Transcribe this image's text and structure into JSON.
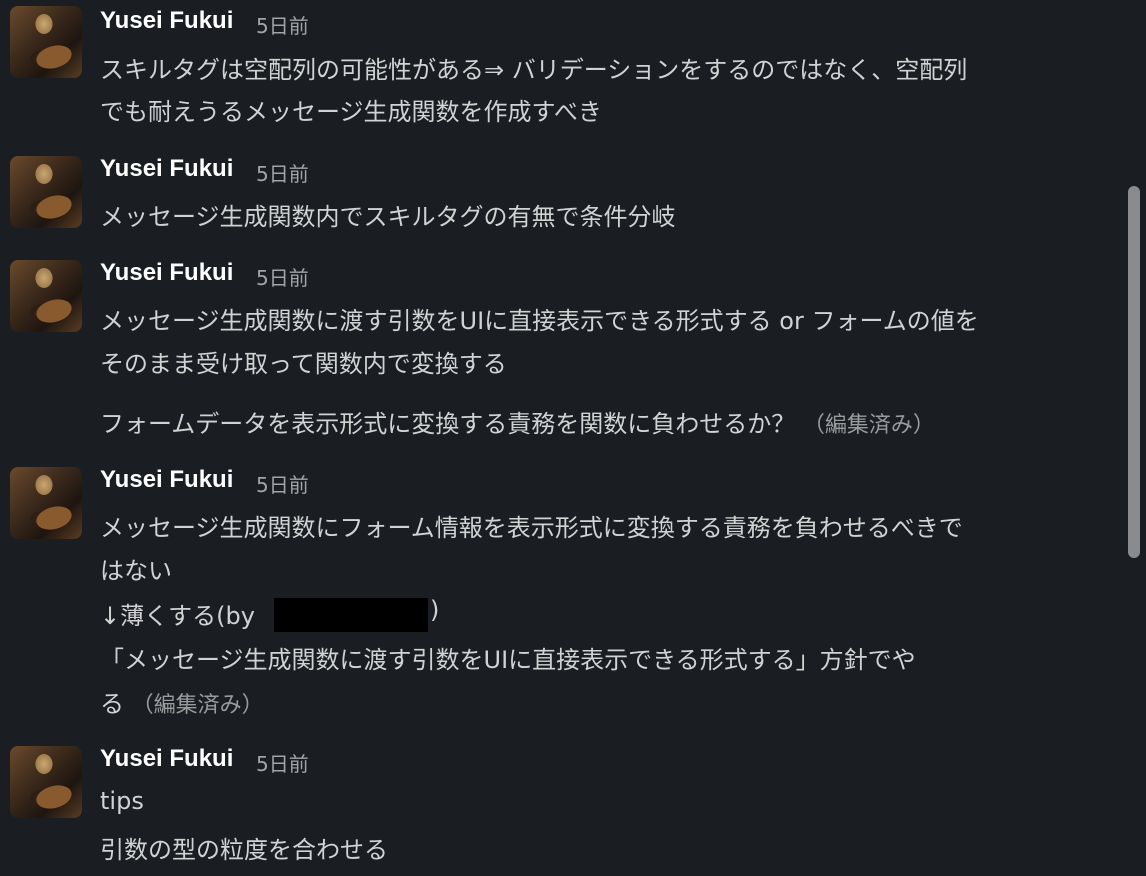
{
  "messages": [
    {
      "author": "Yusei Fukui",
      "time": "5日前",
      "lines": [
        "スキルタグは空配列の可能性がある⇒ バリデーションをするのではなく、空配列",
        "でも耐えうるメッセージ生成関数を作成すべき"
      ]
    },
    {
      "author": "Yusei Fukui",
      "time": "5日前",
      "lines": [
        "メッセージ生成関数内でスキルタグの有無で条件分岐"
      ]
    },
    {
      "author": "Yusei Fukui",
      "time": "5日前",
      "lines": [
        "メッセージ生成関数に渡す引数をUIに直接表示できる形式する or フォームの値を",
        "そのまま受け取って関数内で変換する",
        "フォームデータを表示形式に変換する責務を関数に負わせるか？"
      ],
      "edited": "（編集済み）"
    },
    {
      "author": "Yusei Fukui",
      "time": "5日前",
      "lines": [
        "メッセージ生成関数にフォーム情報を表示形式に変換する責務を負わせるべきで",
        "はない",
        "↓薄くする(by",
        ")",
        "「メッセージ生成関数に渡す引数をUIに直接表示できる形式する」方針でや",
        "る"
      ],
      "edited": "（編集済み）"
    },
    {
      "author": "Yusei Fukui",
      "time": "5日前",
      "lines": [
        "tips",
        "引数の型の粒度を合わせる"
      ]
    }
  ]
}
